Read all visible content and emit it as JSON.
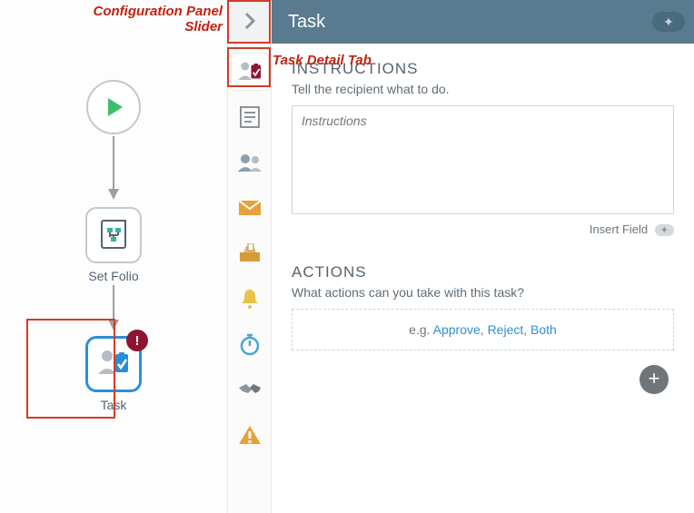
{
  "annotations": {
    "slider_label_line1": "Configuration Panel",
    "slider_label_line2": "Slider",
    "task_tab_label": "Task Detail Tab"
  },
  "workflow": {
    "step1_label": "Set Folio",
    "step2_label": "Task"
  },
  "panel": {
    "title": "Task",
    "instructions_heading": "INSTRUCTIONS",
    "instructions_sub": "Tell the recipient what to do.",
    "instructions_placeholder": "Instructions",
    "insert_field": "Insert Field",
    "actions_heading": "ACTIONS",
    "actions_sub": "What actions can you take with this task?",
    "actions_example_prefix": "e.g. ",
    "actions_example_a": "Approve",
    "actions_example_b": "Reject",
    "actions_example_c": "Both"
  }
}
